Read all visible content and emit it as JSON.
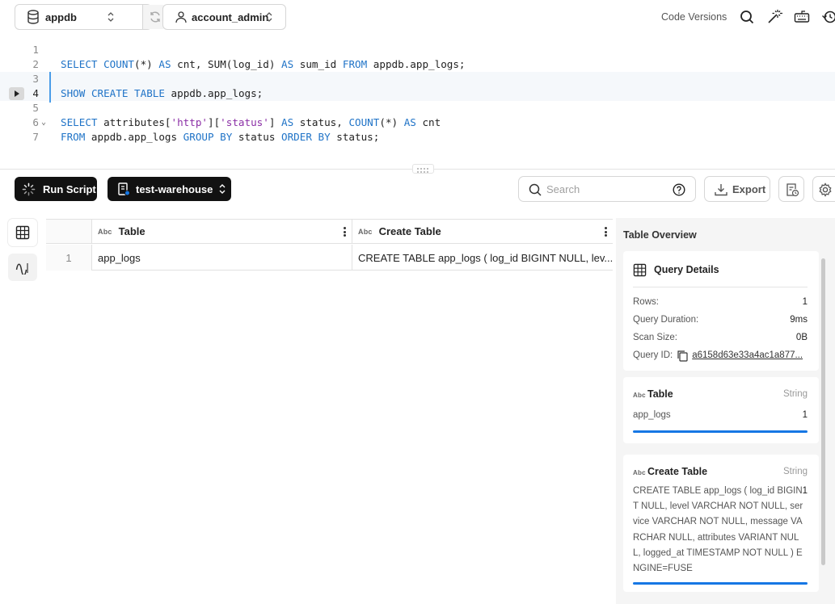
{
  "toolbar": {
    "database": "appdb",
    "role": "account_admin",
    "code_versions_label": "Code Versions"
  },
  "editor": {
    "lines": [
      {
        "num": "1"
      },
      {
        "num": "2"
      },
      {
        "num": "3"
      },
      {
        "num": "4"
      },
      {
        "num": "5"
      },
      {
        "num": "6"
      },
      {
        "num": "7"
      }
    ]
  },
  "actions": {
    "run_label": "Run Script",
    "warehouse": "test-warehouse",
    "search_placeholder": "Search",
    "export_label": "Export"
  },
  "grid": {
    "type_tag": "Abc",
    "columns": [
      "Table",
      "Create Table"
    ],
    "rows": [
      {
        "index": "1",
        "table": "app_logs",
        "create_table": "CREATE TABLE app_logs (   log_id BIGINT NULL,   lev..."
      }
    ]
  },
  "overview": {
    "title": "Table Overview",
    "query_details": {
      "title": "Query Details",
      "rows_label": "Rows:",
      "rows_value": "1",
      "duration_label": "Query Duration:",
      "duration_value": "9ms",
      "scan_label": "Scan Size:",
      "scan_value": "0B",
      "qid_label": "Query ID:",
      "qid_value": "a6158d63e33a4ac1a877..."
    },
    "table_card": {
      "tag": "Abc",
      "title": "Table",
      "type": "String",
      "value": "app_logs",
      "count": "1"
    },
    "create_card": {
      "tag": "Abc",
      "title": "Create Table",
      "type": "String",
      "value": "CREATE TABLE app_logs ( log_id BIGINT NULL, level VARCHAR NOT NULL, service VARCHAR NOT NULL, message VARCHAR NULL, attributes VARIANT NULL, logged_at TIMESTAMP NOT NULL ) ENGINE=FUSE",
      "count": "1"
    }
  },
  "colors": {
    "accent": "#1677e4",
    "keyword": "#1f73c7",
    "string": "#8b2fa6"
  }
}
